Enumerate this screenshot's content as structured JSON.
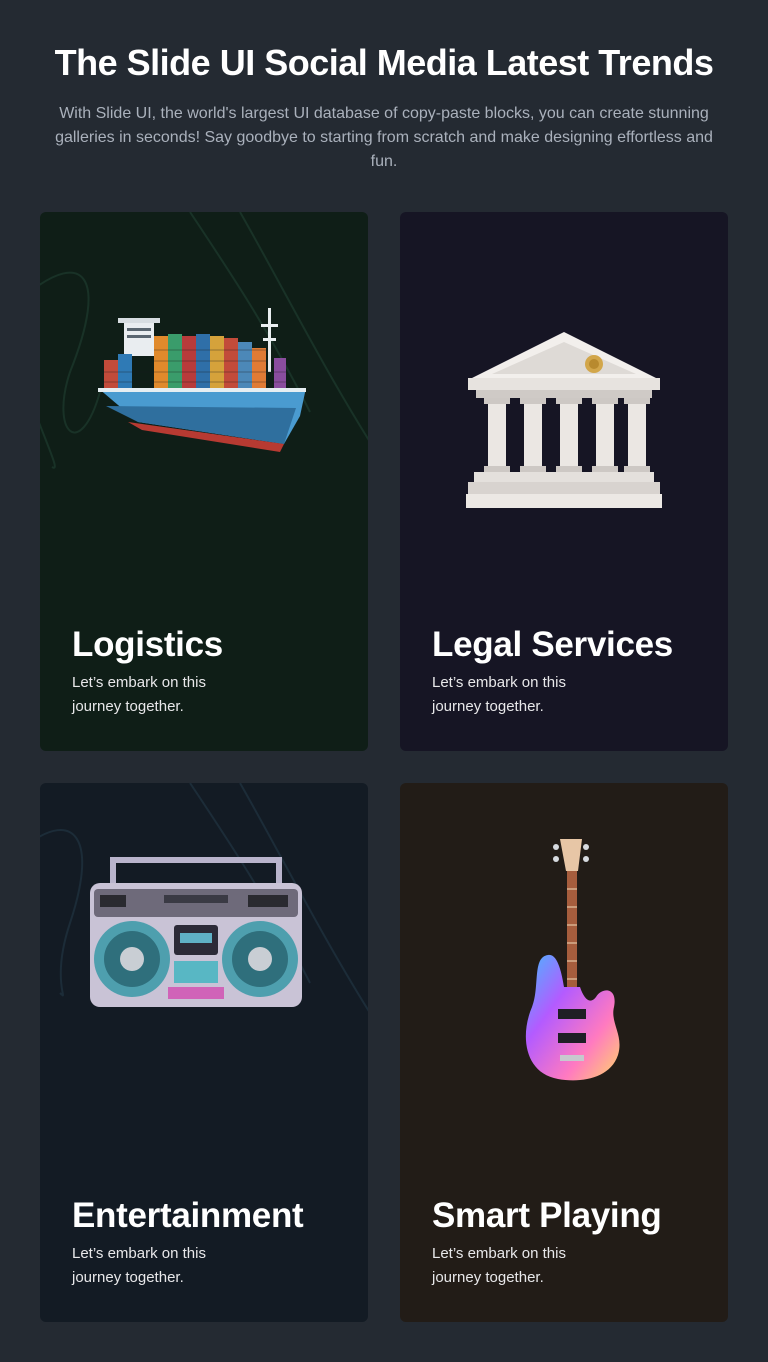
{
  "header": {
    "title": "The Slide UI Social Media Latest Trends",
    "subtitle": "With Slide UI, the world's largest UI database of copy-paste blocks, you can create stunning galleries in seconds! Say goodbye to starting from scratch and make designing effortless and fun."
  },
  "cards": [
    {
      "title": "Logistics",
      "description": "Let’s embark on this journey together.",
      "image": "cargo-ship-icon",
      "background": "#0f1e17"
    },
    {
      "title": "Legal Services",
      "description": "Let’s embark on this journey together.",
      "image": "courthouse-icon",
      "background": "#161524"
    },
    {
      "title": "Entertainment",
      "description": "Let’s embark on this journey together.",
      "image": "boombox-icon",
      "background": "#131b24"
    },
    {
      "title": "Smart Playing",
      "description": "Let’s embark on this journey together.",
      "image": "electric-guitar-icon",
      "background": "#221c17"
    }
  ]
}
